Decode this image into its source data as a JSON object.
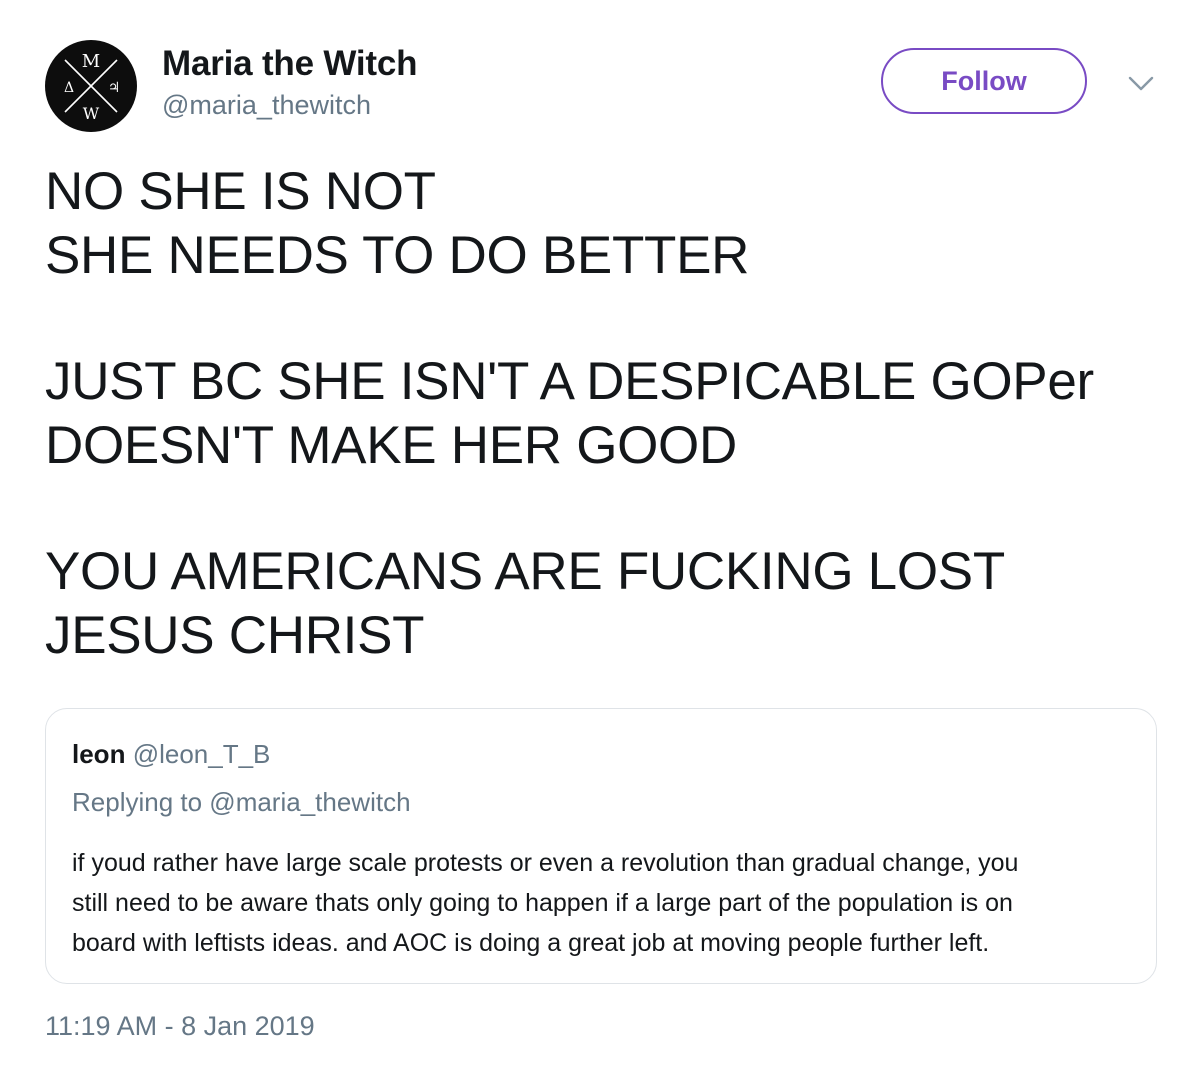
{
  "author": {
    "name": "Maria the Witch",
    "handle": "@maria_thewitch",
    "avatar_letters": {
      "top": "M",
      "left": "Δ",
      "right": "♃",
      "bottom": "W"
    }
  },
  "actions": {
    "follow_label": "Follow",
    "more_icon": "chevron-down-icon"
  },
  "tweet": {
    "lines": [
      "NO SHE IS NOT",
      "SHE NEEDS TO DO BETTER",
      "JUST BC SHE ISN'T A DESPICABLE GOPer",
      "DOESN'T MAKE HER GOOD",
      "YOU AMERICANS ARE FUCKING LOST",
      "JESUS CHRIST"
    ]
  },
  "quote": {
    "name": "leon",
    "handle": "@leon_T_B",
    "replying_to": "Replying to @maria_thewitch",
    "lines": [
      "if youd rather have large scale protests or even a revolution than gradual change, you",
      "still need to be aware thats only going to happen if a large part of the population is on",
      "board with leftists ideas. and AOC is doing a great job at moving people further left."
    ]
  },
  "timestamp": "11:19 AM - 8 Jan 2019",
  "colors": {
    "accent": "#794bc4",
    "text": "#14171a",
    "secondary_text": "#657786",
    "border": "#dfe3e7",
    "avatar_bg": "#0d0d0d"
  }
}
